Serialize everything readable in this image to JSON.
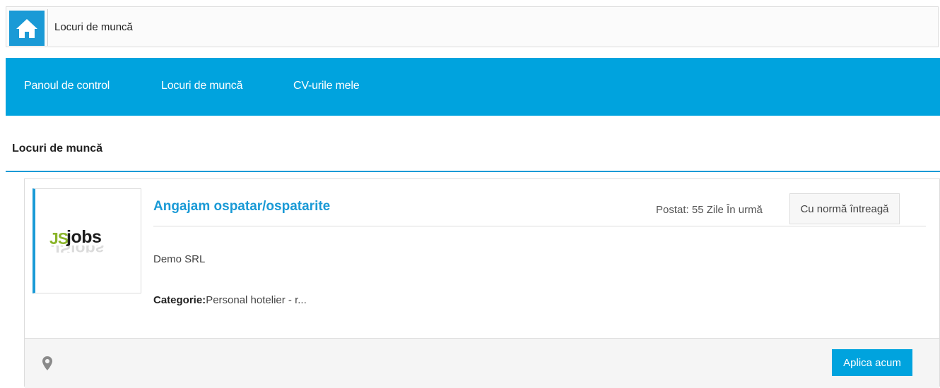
{
  "breadcrumb": {
    "current": "Locuri de muncă"
  },
  "nav": {
    "items": [
      "Panoul de control",
      "Locuri de muncă",
      "CV-urile mele"
    ]
  },
  "page": {
    "title": "Locuri de muncă"
  },
  "job": {
    "logo_text_js": "JS",
    "logo_text_jobs": "jobs",
    "title": "Angajam ospatar/ospatarite",
    "posted": "Postat: 55 Zile În urmă",
    "type": "Cu normă întreagă",
    "company": "Demo SRL",
    "category_label": "Categorie:",
    "category_value": "Personal hotelier - r..."
  },
  "actions": {
    "apply_label": "Aplica acum"
  },
  "icons": {
    "home": "home-icon",
    "location": "map-pin-icon"
  },
  "colors": {
    "accent": "#00a3de",
    "title": "#1a9ad6",
    "logo_green": "#8ab42a"
  }
}
